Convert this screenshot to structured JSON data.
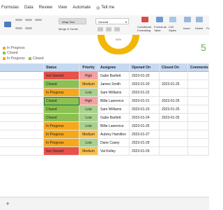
{
  "ribbon_tabs": [
    "Formulas",
    "Data",
    "Review",
    "View",
    "Automate"
  ],
  "tell_me": "Tell me",
  "ribbon": {
    "wrap_text": "Wrap Text",
    "merge_center": "Merge & Center",
    "number_format": "General",
    "conditional_formatting": "Conditional Formatting",
    "format_as_table": "Format as Table",
    "cell_styles": "Cell Styles",
    "insert": "Insert",
    "delete": "Delete",
    "format": "Fo"
  },
  "dashboard": {
    "legend": [
      "In Progress",
      "Closed"
    ],
    "legend_row2": [
      "In Progress",
      "Closed"
    ],
    "gauge_label": "50%",
    "big_number": "5"
  },
  "table": {
    "headers": [
      "Status",
      "Priority",
      "Assignee",
      "Opened On",
      "Closed On",
      "Comments"
    ],
    "rows": [
      {
        "status": "Not Started",
        "priority": "High",
        "assignee": "Gabe Bartlett",
        "opened": "2023-01-20",
        "closed": ""
      },
      {
        "status": "Closed",
        "priority": "Medium",
        "assignee": "James Smith",
        "opened": "2023-01-20",
        "closed": "2023-01-25"
      },
      {
        "status": "In Progress",
        "priority": "Low",
        "assignee": "Sam Williams",
        "opened": "2023-01-22",
        "closed": ""
      },
      {
        "status": "Closed",
        "priority": "High",
        "assignee": "Billie Lawrence",
        "opened": "2023-01-21",
        "closed": "2023-01-25"
      },
      {
        "status": "Closed",
        "priority": "Low",
        "assignee": "Sam Williams",
        "opened": "2023-01-23",
        "closed": "2023-01-25"
      },
      {
        "status": "Closed",
        "priority": "Low",
        "assignee": "Gabe Bartlett",
        "opened": "2023-01-24",
        "closed": "2023-01-25"
      },
      {
        "status": "In Progress",
        "priority": "Low",
        "assignee": "Billie Lawrence",
        "opened": "2023-01-25",
        "closed": ""
      },
      {
        "status": "In Progress",
        "priority": "Medium",
        "assignee": "Aubrey Hamilton",
        "opened": "2023-01-27",
        "closed": ""
      },
      {
        "status": "In Progress",
        "priority": "Low",
        "assignee": "Dane Casey",
        "opened": "2023-01-29",
        "closed": ""
      },
      {
        "status": "Not Started",
        "priority": "Medium",
        "assignee": "Val Kelley",
        "opened": "2023-01-29",
        "closed": ""
      }
    ]
  },
  "colors": {
    "status": {
      "Not Started": "#e8524a",
      "Closed": "#8cc152",
      "In Progress": "#f6a81c"
    },
    "priority": {
      "High": "#f4a1a1",
      "Medium": "#f9c24f",
      "Low": "#a9d18e"
    },
    "header_fill": "#c6d9f1",
    "selected_outline": "#217346"
  },
  "selected_row": 3
}
